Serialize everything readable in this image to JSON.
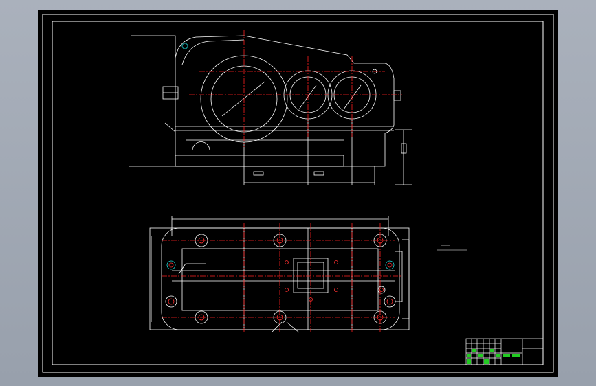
{
  "window": {
    "title": ""
  },
  "colors": {
    "background": "#a4abb6",
    "sheet": "#000000",
    "outline": "#ffffff",
    "centerline": "#ff2020",
    "hole": "#ff3030",
    "accent": "#20e0e0",
    "title_block_fill": "#22cc22"
  },
  "sheet": {
    "views": [
      "front-view",
      "top-view"
    ],
    "title_block": {
      "filled": true
    }
  }
}
